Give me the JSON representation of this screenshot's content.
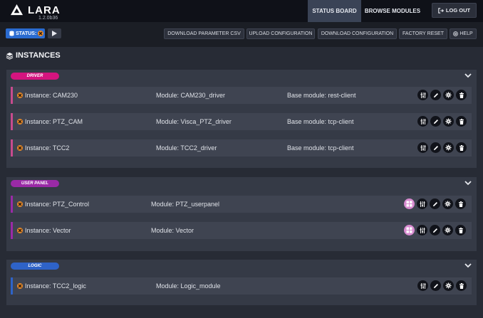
{
  "app": {
    "name": "LARA",
    "version": "1.2.0b36"
  },
  "nav": {
    "tabs": [
      {
        "label": "STATUS BOARD"
      },
      {
        "label": "BROWSE MODULES"
      }
    ],
    "logout_label": "LOG OUT"
  },
  "toolbar": {
    "status_label": "STATUS:",
    "buttons": [
      {
        "label": "DOWNLOAD PARAMETER CSV"
      },
      {
        "label": "UPLOAD CONFIGURATION"
      },
      {
        "label": "DOWNLOAD CONFIGURATION"
      },
      {
        "label": "FACTORY RESET"
      },
      {
        "label": "HELP"
      }
    ]
  },
  "main": {
    "title": "INSTANCES"
  },
  "colors": {
    "driver": "#d4147f",
    "user_panel": "#9a2aa6",
    "logic": "#2e63c8",
    "status": "#2a6bd0",
    "error": "#e88a2a"
  },
  "sections": [
    {
      "badge": "DRIVER",
      "rows": [
        {
          "instance": "Instance: CAM230",
          "module": "Module: CAM230_driver",
          "base": "Base module: rest-client"
        },
        {
          "instance": "Instance: PTZ_CAM",
          "module": "Module: Visca_PTZ_driver",
          "base": "Base module: tcp-client"
        },
        {
          "instance": "Instance: TCC2",
          "module": "Module: TCC2_driver",
          "base": "Base module: tcp-client"
        }
      ]
    },
    {
      "badge": "USER PANEL",
      "rows": [
        {
          "instance": "Instance: PTZ_Control",
          "module": "Module: PTZ_userpanel"
        },
        {
          "instance": "Instance: Vector",
          "module": "Module: Vector"
        }
      ]
    },
    {
      "badge": "LOGIC",
      "rows": [
        {
          "instance": "Instance: TCC2_logic",
          "module": "Module: Logic_module"
        }
      ]
    }
  ]
}
